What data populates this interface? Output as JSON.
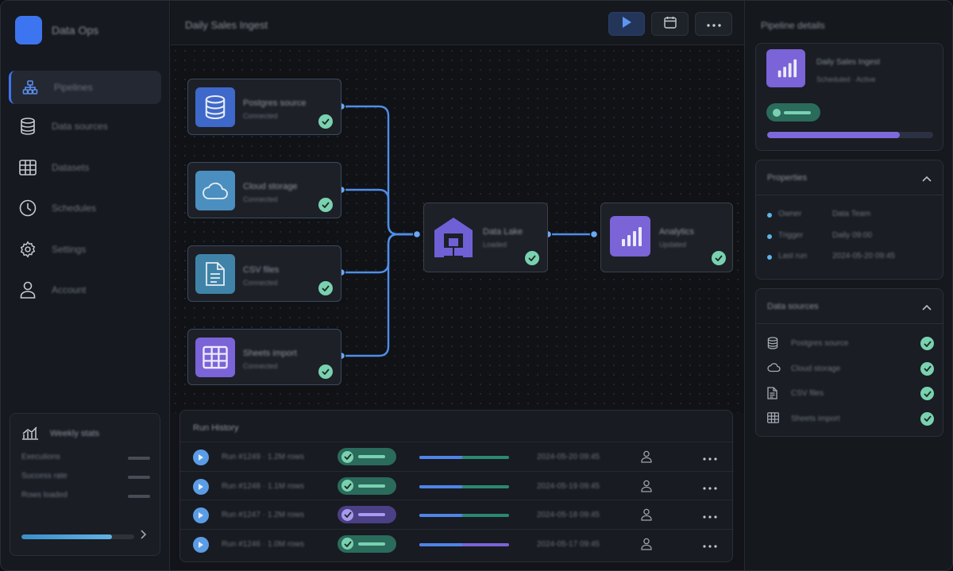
{
  "app": {
    "title": "Data Ops"
  },
  "sidebar": {
    "items": [
      {
        "label": "Pipelines",
        "icon": "pipeline-icon"
      },
      {
        "label": "Data sources",
        "icon": "database-icon"
      },
      {
        "label": "Datasets",
        "icon": "table-icon"
      },
      {
        "label": "Schedules",
        "icon": "clock-icon"
      },
      {
        "label": "Settings",
        "icon": "gear-icon"
      },
      {
        "label": "Account",
        "icon": "user-icon"
      }
    ],
    "stats": {
      "title": "Weekly stats",
      "rows": [
        {
          "label": "Executions"
        },
        {
          "label": "Success rate"
        },
        {
          "label": "Rows loaded"
        }
      ],
      "progress": 0.8
    }
  },
  "topbar": {
    "title": "Daily Sales Ingest"
  },
  "nodes": {
    "sources": [
      {
        "title": "Postgres source",
        "sub": "Connected",
        "icon": "database-icon",
        "color": "#3e68c9"
      },
      {
        "title": "Cloud storage",
        "sub": "Connected",
        "icon": "cloud-icon",
        "color": "#4a8fbf"
      },
      {
        "title": "CSV files",
        "sub": "Connected",
        "icon": "document-icon",
        "color": "#3f84a8"
      },
      {
        "title": "Sheets import",
        "sub": "Connected",
        "icon": "table-icon",
        "color": "#7b63d8"
      }
    ],
    "warehouse": {
      "title": "Data Lake",
      "sub": "Loaded",
      "icon": "warehouse-icon",
      "color": "#7060d6"
    },
    "output": {
      "title": "Analytics",
      "sub": "Updated",
      "icon": "chart-icon",
      "color": "#7b63d8"
    }
  },
  "history": {
    "title": "Run History",
    "rows": [
      {
        "name": "Run #1249 · 1.2M rows",
        "status": "success",
        "progress": 0.48,
        "date": "2024-05-20 09:45"
      },
      {
        "name": "Run #1248 · 1.1M rows",
        "status": "success",
        "progress": 0.48,
        "date": "2024-05-19 09:45"
      },
      {
        "name": "Run #1247 · 1.2M rows",
        "status": "running",
        "progress": 0.48,
        "date": "2024-05-18 09:45"
      },
      {
        "name": "Run #1246 · 1.0M rows",
        "status": "success",
        "progress": 0.48,
        "date": "2024-05-17 09:45"
      }
    ]
  },
  "right": {
    "title": "Pipeline details",
    "summary": {
      "title": "Daily Sales Ingest",
      "sub": "Scheduled · Active",
      "progress": 0.8
    },
    "properties": {
      "title": "Properties",
      "items": [
        {
          "key": "Owner",
          "value": "Data Team"
        },
        {
          "key": "Trigger",
          "value": "Daily 09:00"
        },
        {
          "key": "Last run",
          "value": "2024-05-20 09:45"
        }
      ]
    },
    "sources": {
      "title": "Data sources",
      "items": [
        {
          "name": "Postgres source",
          "icon": "database-icon"
        },
        {
          "name": "Cloud storage",
          "icon": "cloud-icon"
        },
        {
          "name": "CSV files",
          "icon": "document-icon"
        },
        {
          "name": "Sheets import",
          "icon": "table-icon"
        }
      ]
    }
  },
  "colors": {
    "accent": "#3d74f0",
    "success": "#7ad1b0",
    "purple": "#7b63d8",
    "wire": "#4f8ee8"
  }
}
